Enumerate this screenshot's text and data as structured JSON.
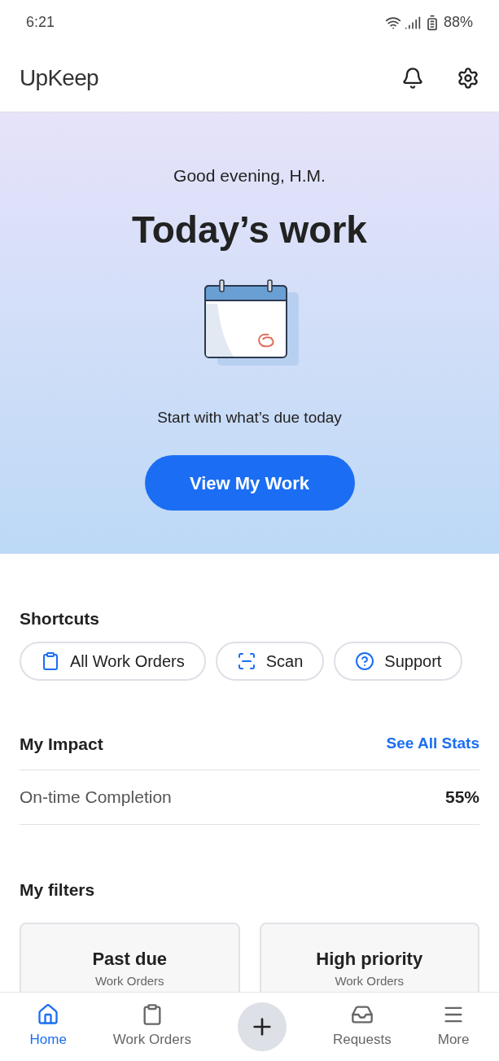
{
  "status_bar": {
    "time": "6:21",
    "battery": "88%"
  },
  "header": {
    "logo": "UpKeep"
  },
  "hero": {
    "greeting": "Good evening, H.M.",
    "title": "Today’s work",
    "subtitle": "Start with what’s due today",
    "button": "View My Work"
  },
  "shortcuts": {
    "title": "Shortcuts",
    "items": [
      {
        "kind": "clipboard",
        "label": "All Work Orders"
      },
      {
        "kind": "scan",
        "label": "Scan"
      },
      {
        "kind": "help",
        "label": "Support"
      }
    ]
  },
  "impact": {
    "title": "My Impact",
    "link": "See All Stats",
    "rows": [
      {
        "label": "On-time Completion",
        "value": "55%"
      }
    ]
  },
  "filters": {
    "title": "My filters",
    "cards": [
      {
        "title": "Past due",
        "subtitle": "Work Orders"
      },
      {
        "title": "High priority",
        "subtitle": "Work Orders"
      }
    ]
  },
  "nav": [
    {
      "kind": "home",
      "label": "Home",
      "selected": true
    },
    {
      "kind": "clipboard",
      "label": "Work Orders",
      "selected": false
    },
    {
      "kind": "add"
    },
    {
      "kind": "inbox",
      "label": "Requests",
      "selected": false
    },
    {
      "kind": "menu",
      "label": "More",
      "selected": false
    }
  ]
}
